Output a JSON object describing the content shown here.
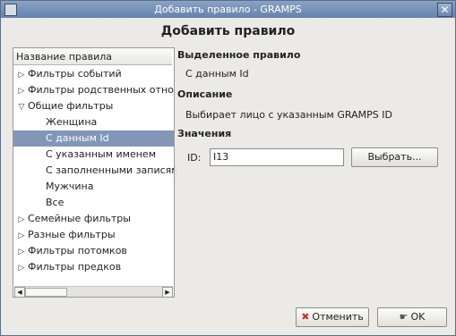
{
  "window": {
    "title": "Добавить правило - GRAMPS",
    "close_glyph": "✕"
  },
  "dialog_title": "Добавить правило",
  "tree": {
    "header": "Название правила",
    "rows": [
      {
        "label": "Фильтры событий",
        "expander": "▷"
      },
      {
        "label": "Фильтры родственных отношений",
        "expander": "▷"
      },
      {
        "label": "Общие фильтры",
        "expander": "▽"
      },
      {
        "label": "Женщина",
        "expander": ""
      },
      {
        "label": "С данным Id",
        "expander": ""
      },
      {
        "label": "С указанным именем",
        "expander": ""
      },
      {
        "label": "С заполненными записями",
        "expander": ""
      },
      {
        "label": "Мужчина",
        "expander": ""
      },
      {
        "label": "Все",
        "expander": ""
      },
      {
        "label": "Семейные фильтры",
        "expander": "▷"
      },
      {
        "label": "Разные фильтры",
        "expander": "▷"
      },
      {
        "label": "Фильтры потомков",
        "expander": "▷"
      },
      {
        "label": "Фильтры предков",
        "expander": "▷"
      }
    ],
    "selected_label": "С данным Id"
  },
  "selected_rule": {
    "heading": "Выделенное правило",
    "value": "С данным Id"
  },
  "description": {
    "heading": "Описание",
    "value": "Выбирает лицо с указанным GRAMPS ID"
  },
  "values": {
    "heading": "Значения",
    "id_label": "ID:",
    "id_value": "I13",
    "select_button": "Выбрать..."
  },
  "buttons": {
    "cancel": "Отменить",
    "ok": "OK"
  },
  "colors": {
    "selection": "#8297b7",
    "titlebar": "#7690b6"
  }
}
